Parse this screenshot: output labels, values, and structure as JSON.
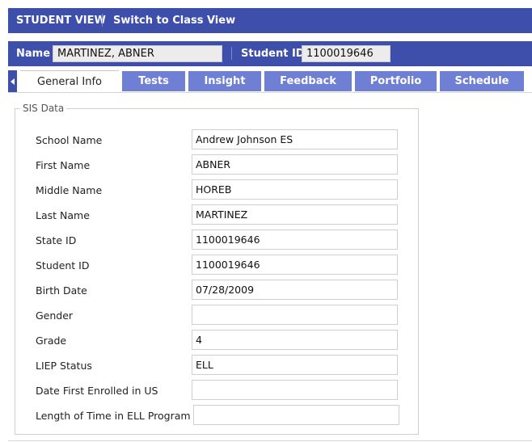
{
  "header": {
    "view_label": "STUDENT VIEW",
    "switch_label": "Switch to Class View"
  },
  "student_bar": {
    "name_label": "Name",
    "name_value": "MARTINEZ, ABNER",
    "id_label": "Student ID",
    "id_value": "1100019646"
  },
  "tabs": [
    {
      "label": "General Info",
      "active": true
    },
    {
      "label": "Tests",
      "active": false
    },
    {
      "label": "Insight",
      "active": false
    },
    {
      "label": "Feedback",
      "active": false
    },
    {
      "label": "Portfolio",
      "active": false
    },
    {
      "label": "Schedule",
      "active": false
    }
  ],
  "sis": {
    "legend": "SIS Data",
    "fields": [
      {
        "label": "School Name",
        "value": "Andrew Johnson ES"
      },
      {
        "label": "First Name",
        "value": "ABNER"
      },
      {
        "label": "Middle Name",
        "value": "HOREB"
      },
      {
        "label": "Last Name",
        "value": "MARTINEZ"
      },
      {
        "label": "State ID",
        "value": "1100019646"
      },
      {
        "label": "Student ID",
        "value": "1100019646"
      },
      {
        "label": "Birth Date",
        "value": "07/28/2009"
      },
      {
        "label": "Gender",
        "value": ""
      },
      {
        "label": "Grade",
        "value": "4"
      },
      {
        "label": "LIEP Status",
        "value": "ELL"
      },
      {
        "label": "Date First Enrolled in US",
        "value": ""
      },
      {
        "label": "Length of Time in ELL Program",
        "value": ""
      }
    ]
  },
  "colors": {
    "primary_bar": "#3d4fab",
    "tab_inactive": "#6f7fd3",
    "field_border": "#cfcfcf"
  }
}
